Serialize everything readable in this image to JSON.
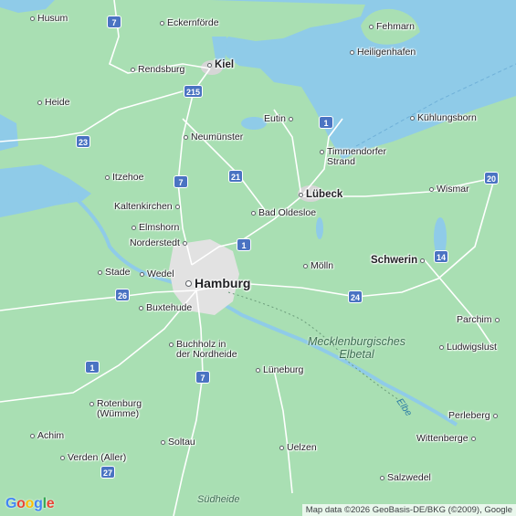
{
  "map": {
    "attribution": "Map data ©2026 GeoBasis-DE/BKG (©2009), Google",
    "logo": [
      "G",
      "o",
      "o",
      "g",
      "l",
      "e"
    ],
    "logo_colors": [
      "#4285f4",
      "#ea4335",
      "#fbbc05",
      "#4285f4",
      "#34a853",
      "#ea4335"
    ],
    "colors": {
      "land": "#a9dfb3",
      "sea": "#8fcbe8",
      "urban": "#e2e2e2",
      "road": "#ffffff",
      "motorway_shield": "#4a73c2"
    },
    "places": {
      "husum": "Husum",
      "eckernfoerde": "Eckernförde",
      "fehmarn": "Fehmarn",
      "heiligenhafen": "Heiligenhafen",
      "rendsburg": "Rendsburg",
      "kiel": "Kiel",
      "heide": "Heide",
      "eutin": "Eutin",
      "kuehlungsborn": "Kühlungsborn",
      "neumuenster": "Neumünster",
      "timmendorfer": "Timmendorfer\nStrand",
      "itzehoe": "Itzehoe",
      "wismar": "Wismar",
      "luebeck": "Lübeck",
      "kaltenkirchen": "Kaltenkirchen",
      "bad_oldesloe": "Bad Oldesloe",
      "elmshorn": "Elmshorn",
      "norderstedt": "Norderstedt",
      "schwerin": "Schwerin",
      "moelln": "Mölln",
      "stade": "Stade",
      "wedel": "Wedel",
      "hamburg": "Hamburg",
      "buxtehude": "Buxtehude",
      "parchim": "Parchim",
      "buchholz": "Buchholz in\nder Nordheide",
      "ludwigslust": "Ludwigslust",
      "lueneburg": "Lüneburg",
      "rotenburg": "Rotenburg\n(Wümme)",
      "perleberg": "Perleberg",
      "achim": "Achim",
      "soltau": "Soltau",
      "wittenberge": "Wittenberge",
      "verden": "Verden (Aller)",
      "uelzen": "Uelzen",
      "salzwedel": "Salzwedel"
    },
    "regions": {
      "mecklenburgisches_elbetal": "Mecklenburgisches\nElbetal",
      "suedheide": "Südheide"
    },
    "water_labels": {
      "elbe": "Elbe"
    },
    "shields": [
      "7",
      "215",
      "1",
      "23",
      "7",
      "21",
      "1",
      "20",
      "14",
      "26",
      "24",
      "1",
      "7",
      "27"
    ]
  }
}
